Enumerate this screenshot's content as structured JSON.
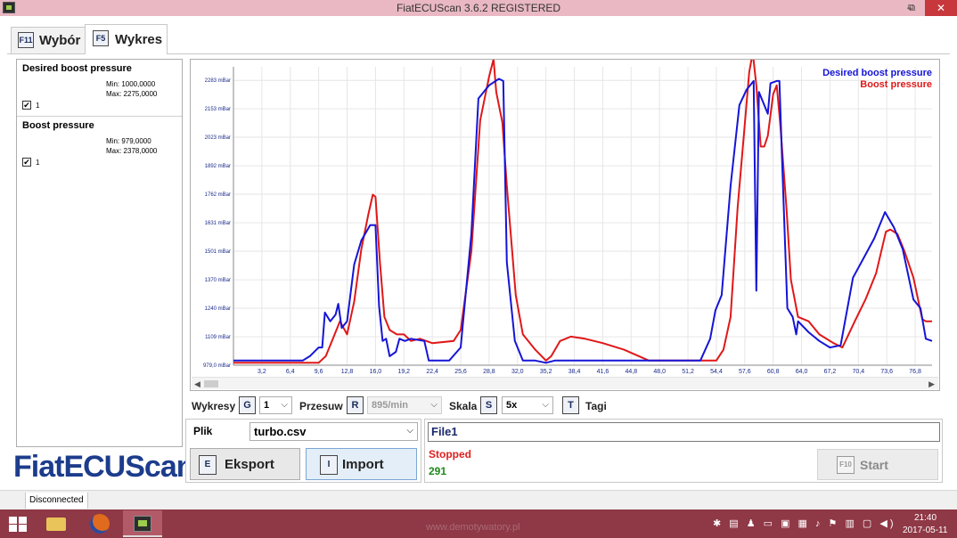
{
  "window": {
    "title": "FiatECUScan 3.6.2 REGISTERED",
    "min_label": "–",
    "max_label": "⧉",
    "close_label": "✕"
  },
  "tabs": [
    {
      "key": "F11",
      "label": "Wybór"
    },
    {
      "key": "F5",
      "label": "Wykres"
    }
  ],
  "signals": [
    {
      "name": "Desired boost pressure",
      "min": "Min: 1000,0000",
      "max": "Max: 2275,0000",
      "checked": "✔",
      "number": "1",
      "color": "#1515d6"
    },
    {
      "name": "Boost pressure",
      "min": "Min: 979,0000",
      "max": "Max: 2378,0000",
      "checked": "✔",
      "number": "1",
      "color": "#e01818"
    }
  ],
  "logo": "FiatECUScan",
  "chart_data": {
    "type": "line",
    "legend": "top-right",
    "y_ticks": [
      "979,0 mBar",
      "1109 mBar",
      "1240 mBar",
      "1370 mBar",
      "1501 mBar",
      "1631 mBar",
      "1762 mBar",
      "1892 mBar",
      "2023 mBar",
      "2153 mBar",
      "2283 mBar"
    ],
    "x_ticks": [
      "3,2",
      "6,4",
      "9,6",
      "12,8",
      "16,0",
      "19,2",
      "22,4",
      "25,6",
      "28,8",
      "32,0",
      "35,2",
      "38,4",
      "41,6",
      "44,8",
      "48,0",
      "51,2",
      "54,4",
      "57,6",
      "60,8",
      "64,0",
      "67,2",
      "70,4",
      "73,6",
      "76,8"
    ],
    "xlim": [
      0,
      78.7
    ],
    "ylim": [
      979,
      2345
    ],
    "grid": true,
    "series": [
      {
        "name": "Desired boost pressure",
        "color": "#1515d6",
        "points": [
          [
            0,
            1000
          ],
          [
            7.8,
            1000
          ],
          [
            8.6,
            1020
          ],
          [
            9.6,
            1060
          ],
          [
            10.0,
            1060
          ],
          [
            10.3,
            1220
          ],
          [
            10.9,
            1180
          ],
          [
            11.5,
            1210
          ],
          [
            11.8,
            1260
          ],
          [
            12.2,
            1150
          ],
          [
            12.8,
            1180
          ],
          [
            13.6,
            1440
          ],
          [
            14.4,
            1550
          ],
          [
            15.4,
            1620
          ],
          [
            16.0,
            1620
          ],
          [
            16.4,
            1250
          ],
          [
            16.8,
            1090
          ],
          [
            17.2,
            1100
          ],
          [
            17.6,
            1020
          ],
          [
            18.3,
            1040
          ],
          [
            18.7,
            1100
          ],
          [
            19.3,
            1090
          ],
          [
            20.0,
            1100
          ],
          [
            21.5,
            1090
          ],
          [
            22.0,
            1000
          ],
          [
            24.3,
            1000
          ],
          [
            25.6,
            1060
          ],
          [
            26.8,
            1580
          ],
          [
            27.6,
            2200
          ],
          [
            28.8,
            2260
          ],
          [
            29.9,
            2290
          ],
          [
            30.4,
            2280
          ],
          [
            30.8,
            1450
          ],
          [
            31.7,
            1090
          ],
          [
            32.6,
            1000
          ],
          [
            34.0,
            1000
          ],
          [
            35.2,
            990
          ],
          [
            36.2,
            1000
          ],
          [
            52.6,
            1000
          ],
          [
            53.7,
            1100
          ],
          [
            54.3,
            1230
          ],
          [
            55.0,
            1300
          ],
          [
            56.0,
            1800
          ],
          [
            57.0,
            2170
          ],
          [
            57.8,
            2240
          ],
          [
            58.6,
            2280
          ],
          [
            58.9,
            1320
          ],
          [
            59.2,
            2230
          ],
          [
            60.2,
            2130
          ],
          [
            60.5,
            2270
          ],
          [
            61.2,
            2280
          ],
          [
            61.5,
            2280
          ],
          [
            61.8,
            1930
          ],
          [
            62.4,
            1240
          ],
          [
            63.0,
            1200
          ],
          [
            63.4,
            1120
          ],
          [
            63.6,
            1180
          ],
          [
            64.8,
            1130
          ],
          [
            66.0,
            1090
          ],
          [
            67.2,
            1060
          ],
          [
            68.4,
            1070
          ],
          [
            69.8,
            1380
          ],
          [
            71.0,
            1470
          ],
          [
            72.2,
            1560
          ],
          [
            73.4,
            1680
          ],
          [
            74.4,
            1610
          ],
          [
            75.4,
            1510
          ],
          [
            76.6,
            1280
          ],
          [
            77.4,
            1240
          ],
          [
            78.0,
            1100
          ],
          [
            78.7,
            1090
          ]
        ]
      },
      {
        "name": "Boost pressure",
        "color": "#e01818",
        "points": [
          [
            0,
            990
          ],
          [
            9.6,
            990
          ],
          [
            10.4,
            1020
          ],
          [
            11.2,
            1100
          ],
          [
            12.0,
            1180
          ],
          [
            12.8,
            1120
          ],
          [
            13.6,
            1270
          ],
          [
            14.4,
            1510
          ],
          [
            15.2,
            1670
          ],
          [
            15.7,
            1760
          ],
          [
            16.0,
            1750
          ],
          [
            16.5,
            1450
          ],
          [
            17.0,
            1200
          ],
          [
            17.6,
            1140
          ],
          [
            18.4,
            1120
          ],
          [
            19.2,
            1120
          ],
          [
            20.0,
            1090
          ],
          [
            21.0,
            1100
          ],
          [
            22.4,
            1080
          ],
          [
            24.8,
            1090
          ],
          [
            25.6,
            1140
          ],
          [
            26.8,
            1500
          ],
          [
            27.8,
            2100
          ],
          [
            28.8,
            2300
          ],
          [
            29.3,
            2380
          ],
          [
            29.6,
            2230
          ],
          [
            30.3,
            2090
          ],
          [
            30.8,
            1800
          ],
          [
            31.8,
            1300
          ],
          [
            32.6,
            1120
          ],
          [
            34.0,
            1050
          ],
          [
            35.2,
            1000
          ],
          [
            35.8,
            1020
          ],
          [
            36.8,
            1090
          ],
          [
            38.0,
            1110
          ],
          [
            39.6,
            1100
          ],
          [
            41.6,
            1080
          ],
          [
            44.0,
            1050
          ],
          [
            46.8,
            1000
          ],
          [
            54.4,
            1000
          ],
          [
            55.2,
            1050
          ],
          [
            56.0,
            1200
          ],
          [
            56.8,
            1700
          ],
          [
            57.6,
            2080
          ],
          [
            58.1,
            2320
          ],
          [
            58.5,
            2410
          ],
          [
            58.9,
            2260
          ],
          [
            59.4,
            1980
          ],
          [
            59.8,
            1980
          ],
          [
            60.2,
            2030
          ],
          [
            60.8,
            2220
          ],
          [
            61.2,
            2260
          ],
          [
            61.6,
            2080
          ],
          [
            62.3,
            1700
          ],
          [
            62.8,
            1370
          ],
          [
            63.6,
            1200
          ],
          [
            64.8,
            1180
          ],
          [
            66.0,
            1120
          ],
          [
            67.6,
            1080
          ],
          [
            68.6,
            1060
          ],
          [
            70.0,
            1180
          ],
          [
            71.2,
            1280
          ],
          [
            72.4,
            1400
          ],
          [
            73.5,
            1590
          ],
          [
            74.0,
            1600
          ],
          [
            74.8,
            1580
          ],
          [
            75.6,
            1500
          ],
          [
            76.6,
            1380
          ],
          [
            77.6,
            1190
          ],
          [
            78.0,
            1180
          ],
          [
            78.7,
            1180
          ]
        ]
      }
    ]
  },
  "controls": {
    "wykresy_label": "Wykresy",
    "wykresy_key": "G",
    "wykresy_value": "1",
    "przesuw_label": "Przesuw",
    "przesuw_key": "R",
    "przesuw_value": "895/min",
    "skala_label": "Skala",
    "skala_key": "S",
    "skala_value": "5x",
    "tagi_key": "T",
    "tagi_label": "Tagi"
  },
  "file": {
    "plik_label": "Plik",
    "selected": "turbo.csv",
    "eksport_key": "E",
    "eksport_label": "Eksport",
    "import_key": "I",
    "import_label": "Import"
  },
  "session": {
    "name": "File1",
    "status": "Stopped",
    "count": "291",
    "start_key": "F10",
    "start_label": "Start"
  },
  "statusbar": {
    "connection": "Disconnected"
  },
  "taskbar": {
    "watermark": "www.demotywatory.pl",
    "time": "21:40",
    "date": "2017-05-11"
  }
}
